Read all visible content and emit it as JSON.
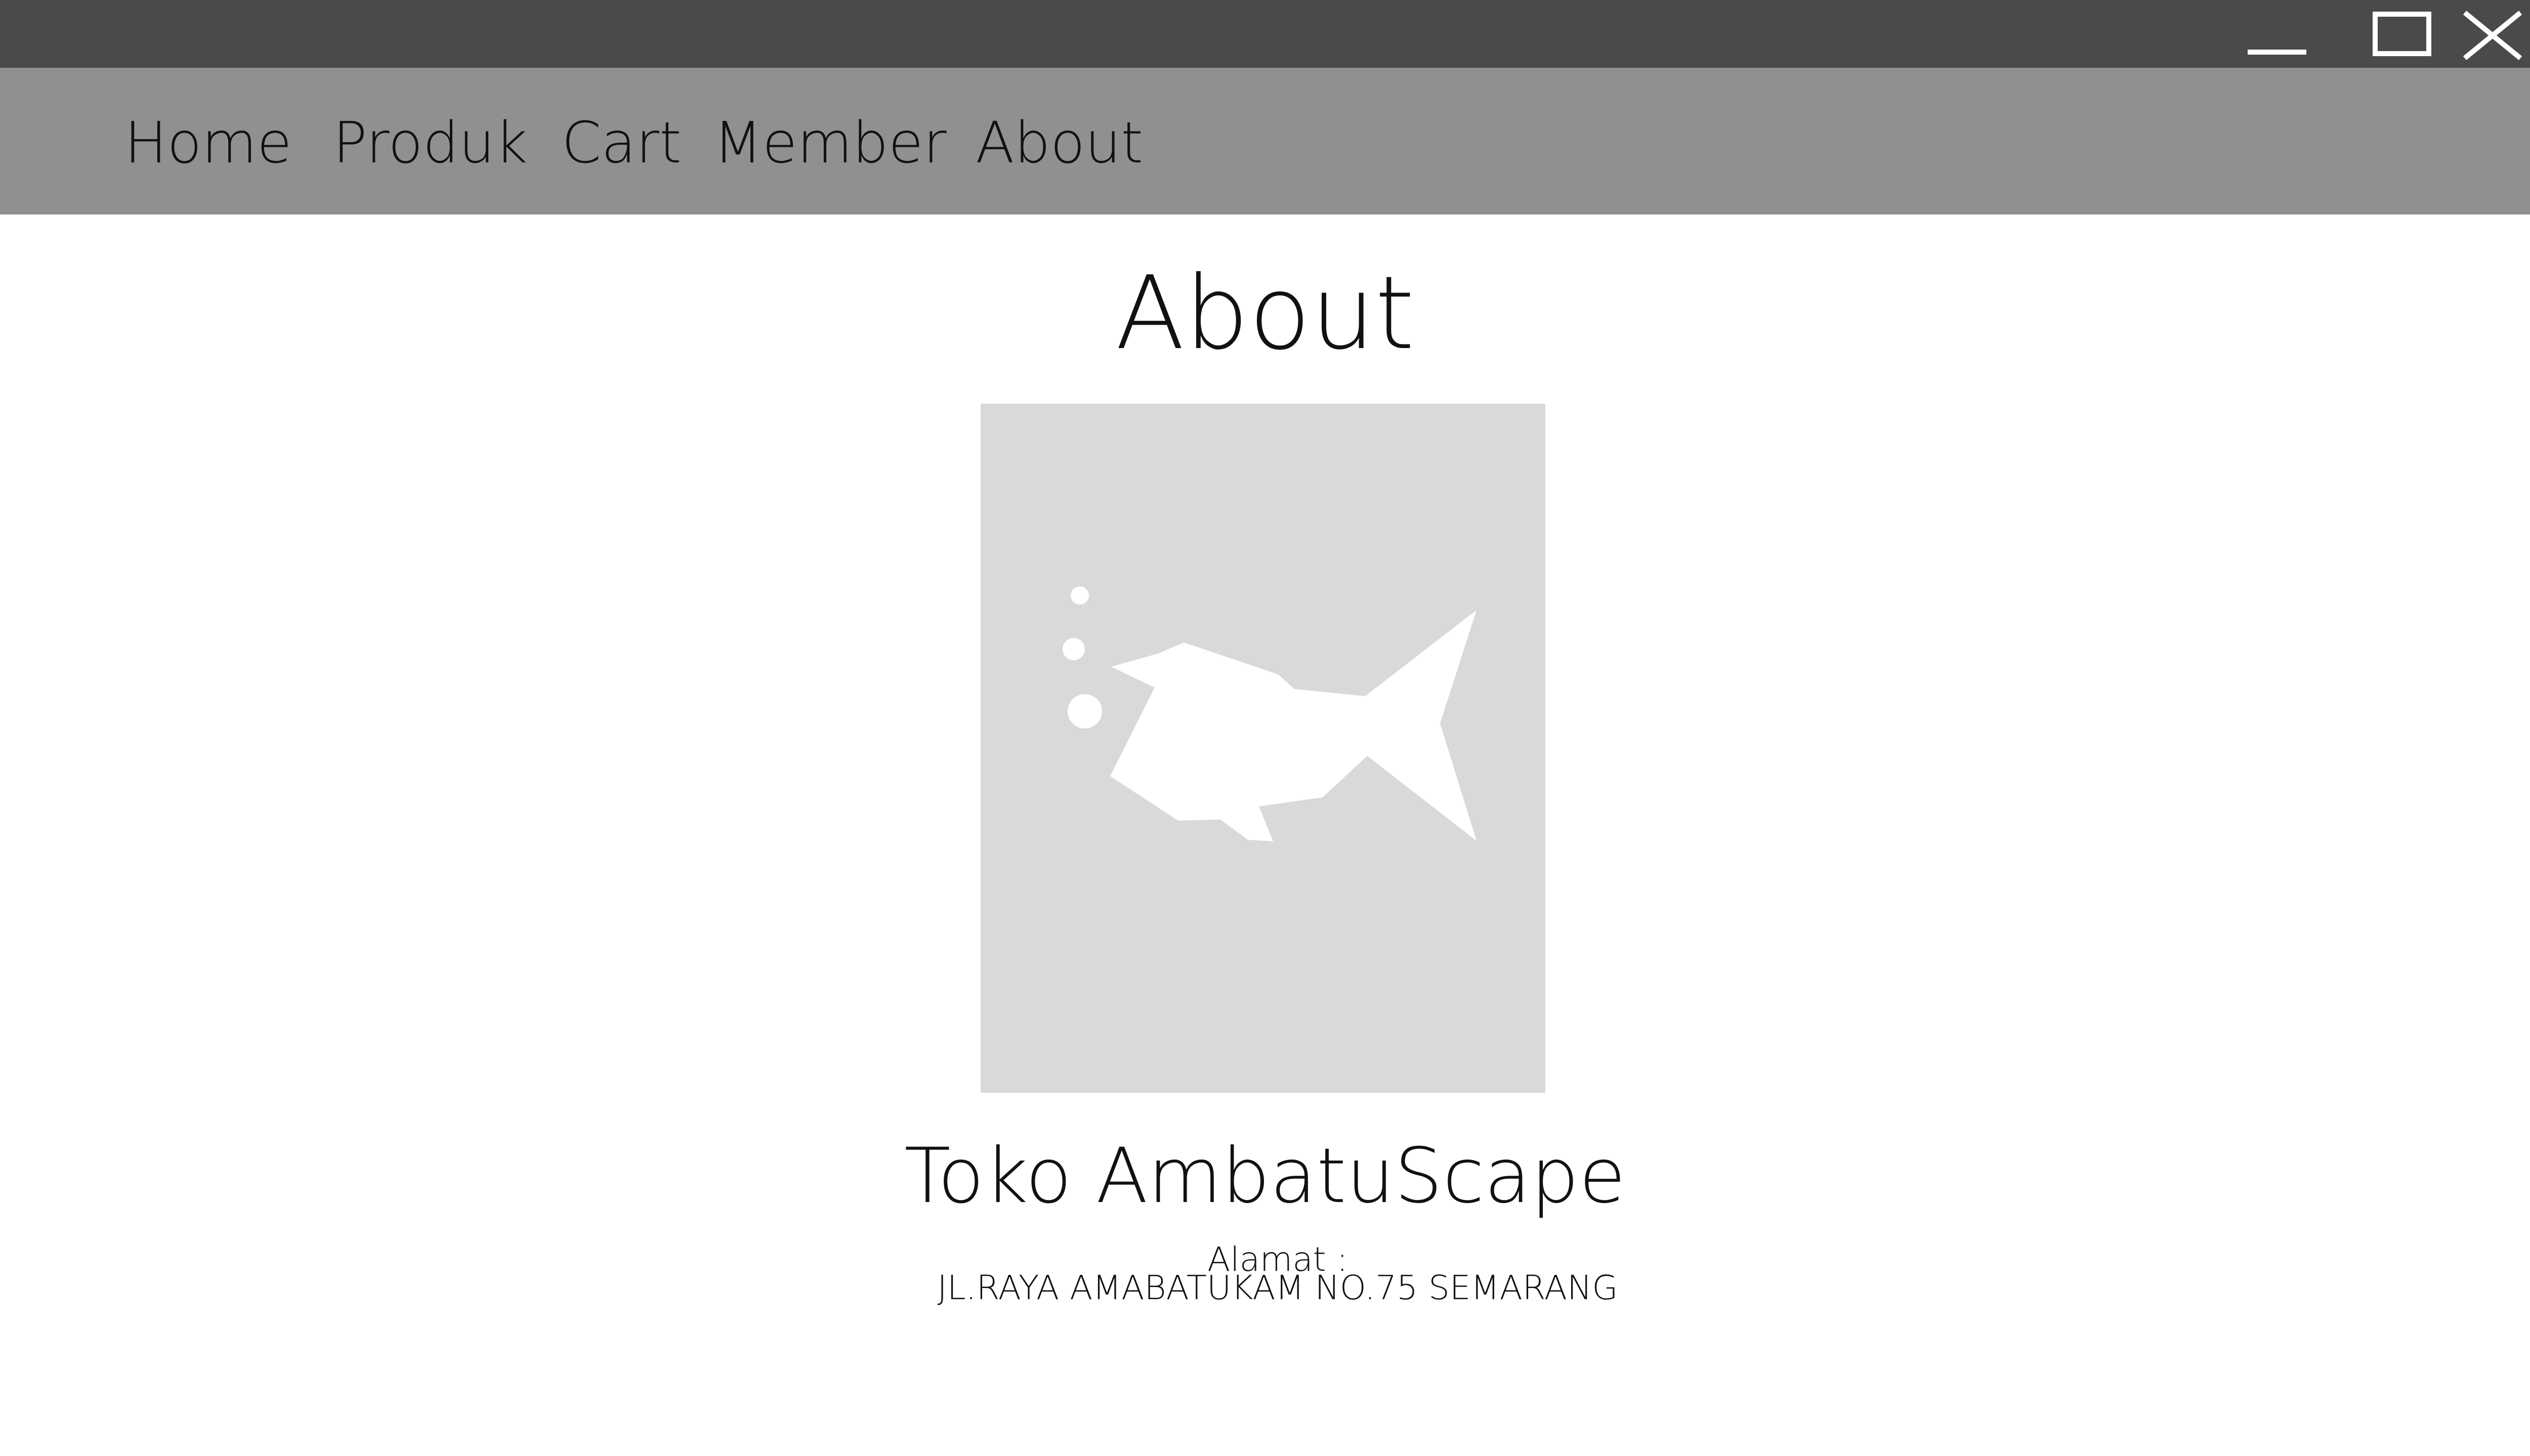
{
  "window": {
    "controls": {
      "minimize": "minimize-icon",
      "maximize": "maximize-icon",
      "close": "close-icon"
    },
    "titlebar_color": "#4a4a4a"
  },
  "nav": {
    "background": "#909090",
    "items": [
      {
        "label": "Home"
      },
      {
        "label": "Produk"
      },
      {
        "label": "Cart"
      },
      {
        "label": "Member"
      },
      {
        "label": "About"
      }
    ]
  },
  "main": {
    "title": "About",
    "image": {
      "icon": "fish-placeholder-icon",
      "background": "#d9d9d9"
    },
    "store_name": "Toko AmbatuScape",
    "address_label": "Alamat :",
    "address_value": "JL.RAYA AMABATUKAM NO.75 SEMARANG"
  }
}
